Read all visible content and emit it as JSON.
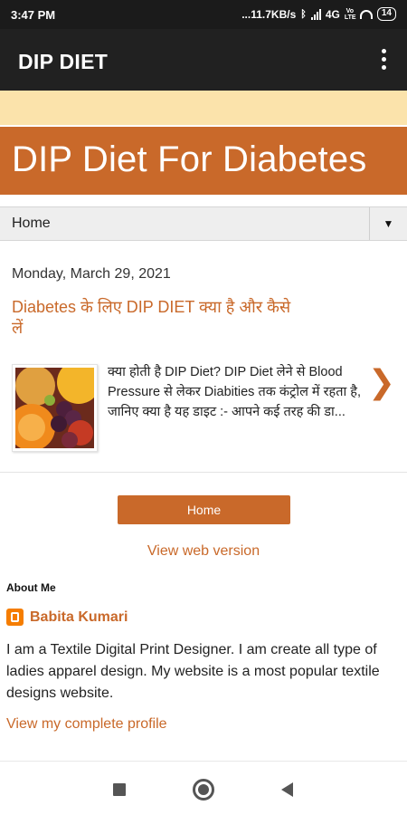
{
  "status_bar": {
    "time": "3:47 PM",
    "speed": "...11.7KB/s",
    "network": "4G",
    "volte": "Vo LTE",
    "battery": "14"
  },
  "app_bar": {
    "title": "DIP DIET",
    "menu_icon": "more-vert-icon"
  },
  "blog": {
    "banner_title": "DIP Diet For Diabetes",
    "nav_label": "Home",
    "nav_dropdown_icon": "caret-down-icon"
  },
  "post": {
    "date": "Monday, March 29, 2021",
    "title": "Diabetes के लिए DIP DIET क्या है और कैसे लें",
    "snippet": "क्या होती है DIP Diet? DIP Diet लेने से Blood Pressure से लेकर Diabities तक कंट्रोल में रहता है, जानिए क्या है यह डाइट :- आपने कई तरह की डा...",
    "next_icon": "chevron-right-icon"
  },
  "footer_links": {
    "home_button": "Home",
    "web_version": "View web version"
  },
  "about": {
    "heading": "About Me",
    "author_name": "Babita Kumari",
    "bio": "I am a Textile Digital Print Designer. I am create all type of ladies apparel design. My website is a most popular textile designs website.",
    "profile_link": "View my complete profile"
  },
  "colors": {
    "accent": "#c9692a",
    "cream": "#fbe3ab",
    "app_bar": "#212121"
  }
}
